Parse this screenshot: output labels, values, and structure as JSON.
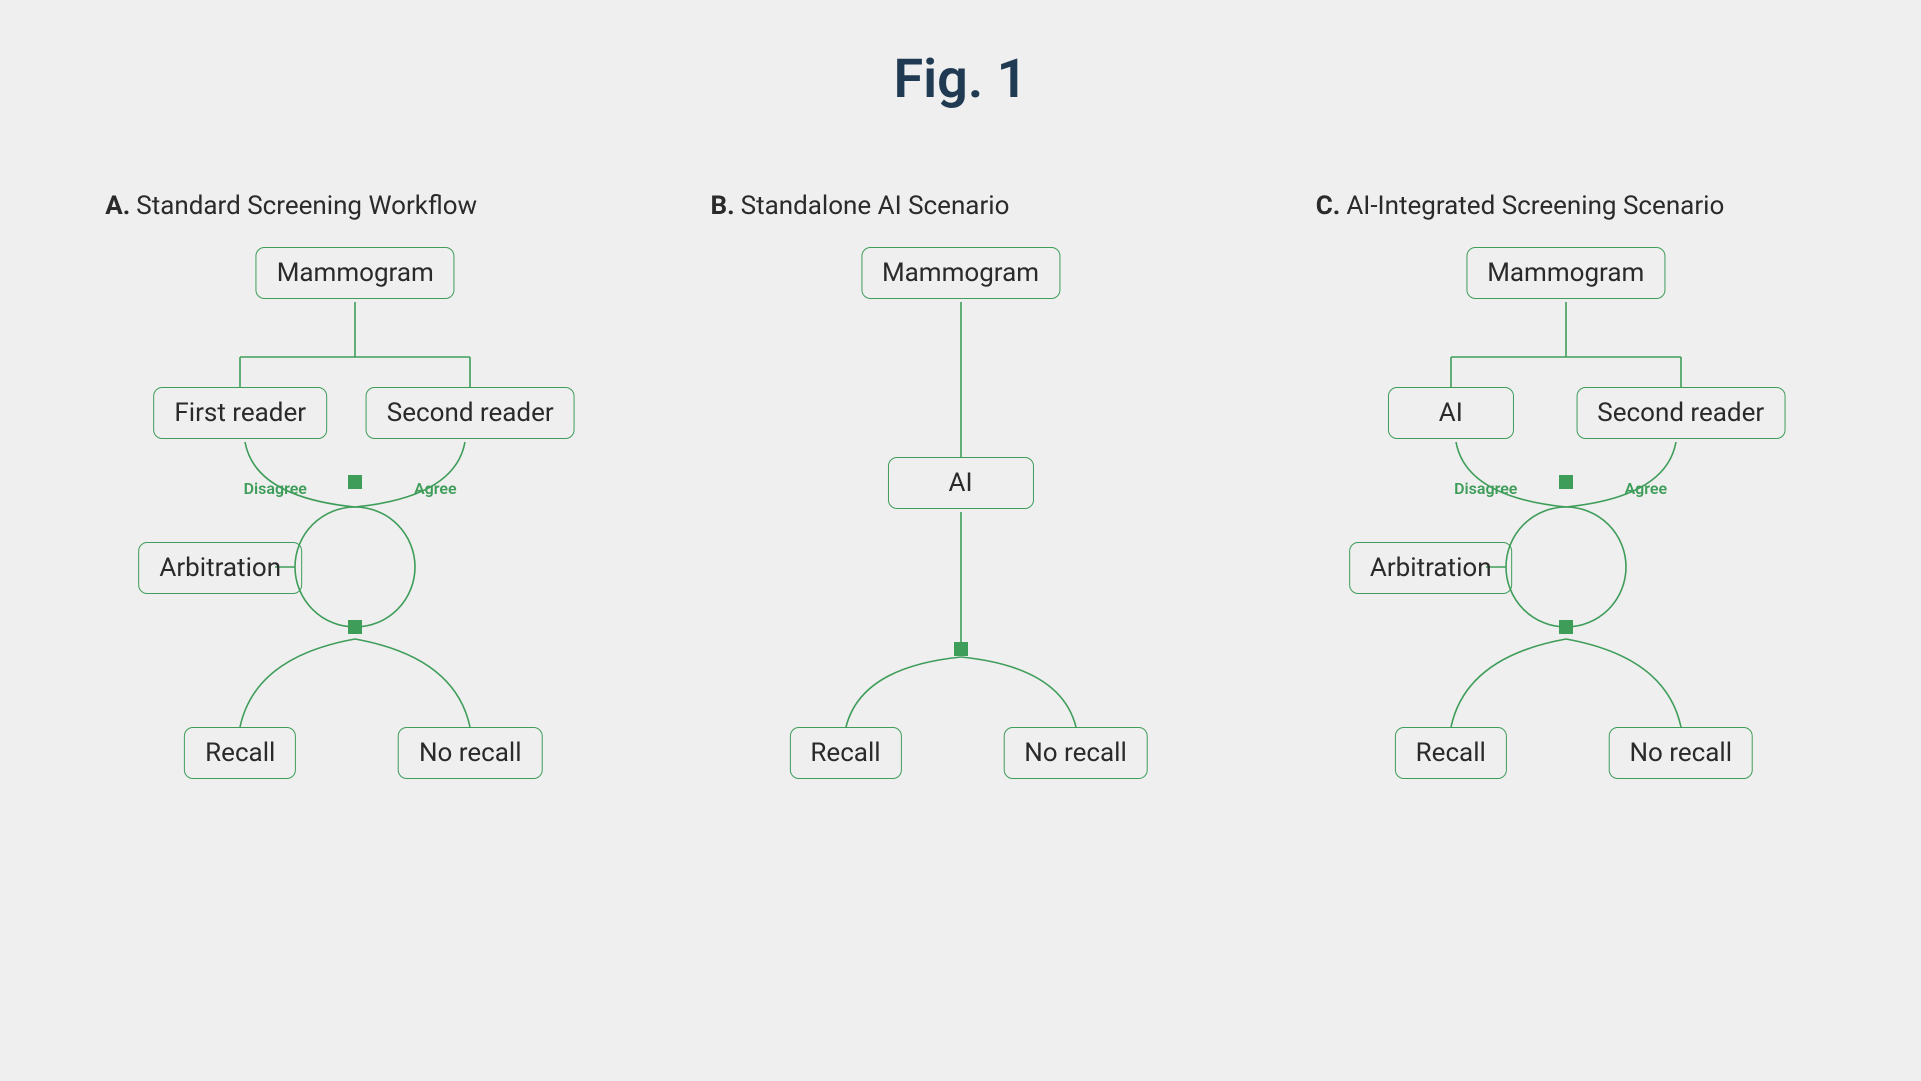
{
  "figure_title": "Fig. 1",
  "panels": {
    "A": {
      "letter": "A.",
      "title": "Standard Screening Workflow",
      "nodes": {
        "root": "Mammogram",
        "reader1": "First reader",
        "reader2": "Second reader",
        "arb": "Arbitration",
        "recall": "Recall",
        "norecall": "No recall"
      },
      "labels": {
        "disagree": "Disagree",
        "agree": "Agree"
      }
    },
    "B": {
      "letter": "B.",
      "title": "Standalone AI Scenario",
      "nodes": {
        "root": "Mammogram",
        "ai": "AI",
        "recall": "Recall",
        "norecall": "No recall"
      }
    },
    "C": {
      "letter": "C.",
      "title": "AI-Integrated Screening Scenario",
      "nodes": {
        "root": "Mammogram",
        "reader1": "AI",
        "reader2": "Second reader",
        "arb": "Arbitration",
        "recall": "Recall",
        "norecall": "No recall"
      },
      "labels": {
        "disagree": "Disagree",
        "agree": "Agree"
      }
    }
  }
}
